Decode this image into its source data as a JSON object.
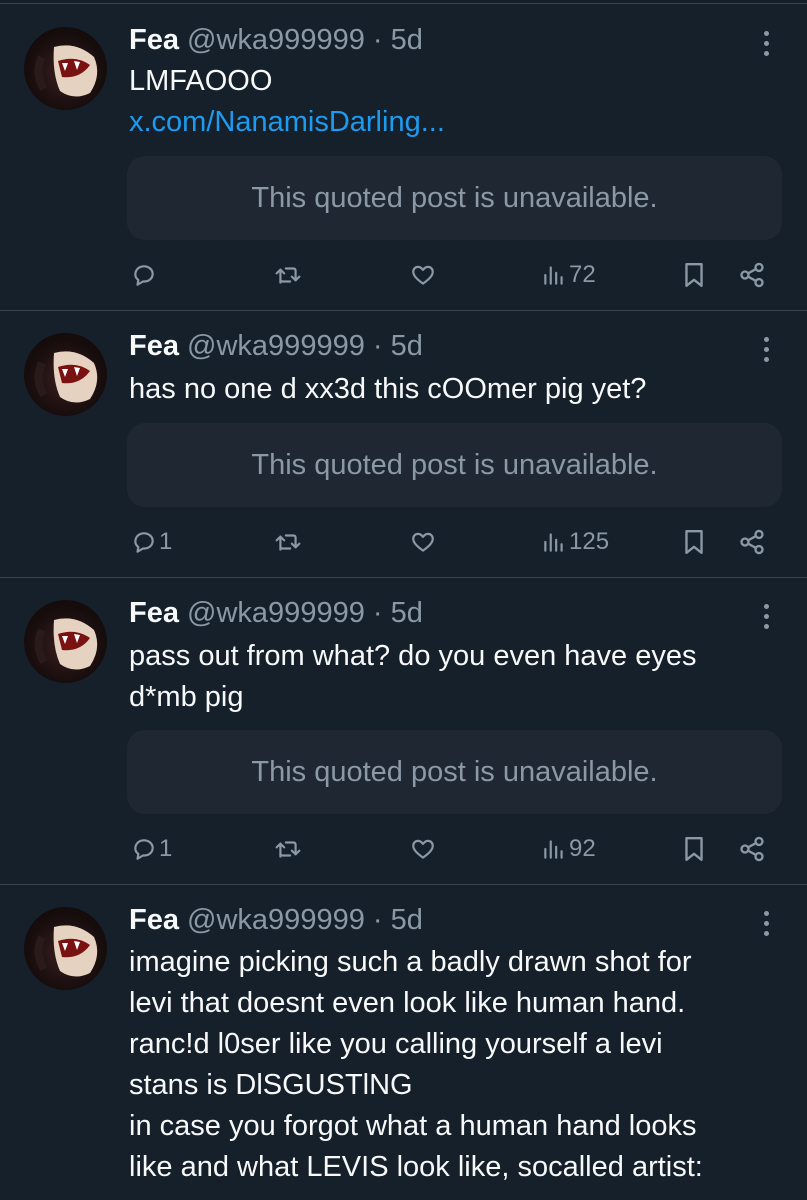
{
  "posts": [
    {
      "name": "Fea",
      "handle": "@wka999999",
      "separator": "·",
      "time": "5d",
      "text_lines": [
        "LMFAOOO"
      ],
      "link": "x.com/NanamisDarling...",
      "quote_text": "This quoted post is unavailable.",
      "reply_count": "",
      "views": "72"
    },
    {
      "name": "Fea",
      "handle": "@wka999999",
      "separator": "·",
      "time": "5d",
      "text_lines": [
        "has no one d xx3d this cOOmer pig yet?"
      ],
      "quote_text": "This quoted post is unavailable.",
      "reply_count": "1",
      "views": "125"
    },
    {
      "name": "Fea",
      "handle": "@wka999999",
      "separator": "·",
      "time": "5d",
      "text_lines": [
        "pass out from what? do you even have eyes",
        "d*mb pig"
      ],
      "quote_text": "This quoted post is unavailable.",
      "reply_count": "1",
      "views": "92"
    },
    {
      "name": "Fea",
      "handle": "@wka999999",
      "separator": "·",
      "time": "5d",
      "text_lines": [
        "imagine picking such a badly drawn shot for",
        "levi that doesnt even look like human hand.",
        "ranc!d l0ser like you calling yourself a levi",
        "stans is DlSGUSTlNG",
        "in case you forgot what a human hand looks",
        "like and what LEVIS look like, socalled artist:"
      ]
    }
  ],
  "icons": {
    "reply": "reply-icon",
    "repost": "repost-icon",
    "like": "like-icon",
    "views": "views-icon",
    "bookmark": "bookmark-icon",
    "share": "share-icon",
    "more": "more-options-icon"
  },
  "colors": {
    "background": "#15202b",
    "divider": "#38444d",
    "text": "#f7f9f9",
    "muted": "#8b98a5",
    "link": "#1d9bf0",
    "quote_bg": "#1e2732"
  }
}
